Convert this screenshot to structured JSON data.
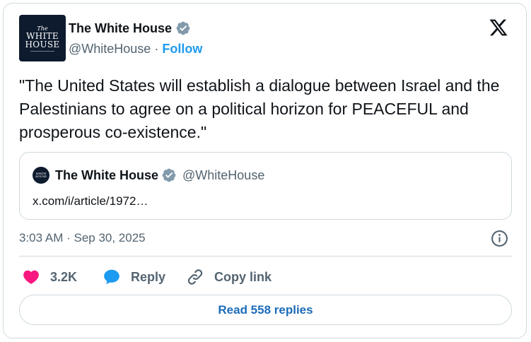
{
  "author": {
    "name": "The White House",
    "handle": "@WhiteHouse",
    "separator": " · ",
    "follow_label": "Follow",
    "avatar_text": {
      "line1": "The",
      "line2": "WHITE",
      "line3": "HOUSE"
    }
  },
  "tweet": {
    "text": "\"The United States will establish a dialogue between Israel and the Palestinians to agree on a political horizon for PEACEFUL and prosperous co-existence.\""
  },
  "quote": {
    "name": "The White House",
    "handle": "@WhiteHouse",
    "link_text": "x.com/i/article/1972…",
    "avatar_text": {
      "line1": "WHITE",
      "line2": "HOUSE"
    }
  },
  "meta": {
    "timestamp": "3:03 AM · Sep 30, 2025"
  },
  "actions": {
    "likes_count": "3.2K",
    "reply_label": "Reply",
    "copy_link_label": "Copy link"
  },
  "read_replies_label": "Read 558 replies",
  "icons": {
    "platform": "x-logo-icon",
    "verified": "verified-badge-icon",
    "info": "info-icon",
    "like": "heart-icon",
    "reply": "speech-bubble-icon",
    "copy_link": "link-icon"
  },
  "colors": {
    "accent": "#1d9bf0",
    "heart": "#f91880",
    "verified_badge": "#829aab",
    "text_primary": "#0f1419",
    "text_secondary": "#536471",
    "border": "#cfd9de"
  }
}
